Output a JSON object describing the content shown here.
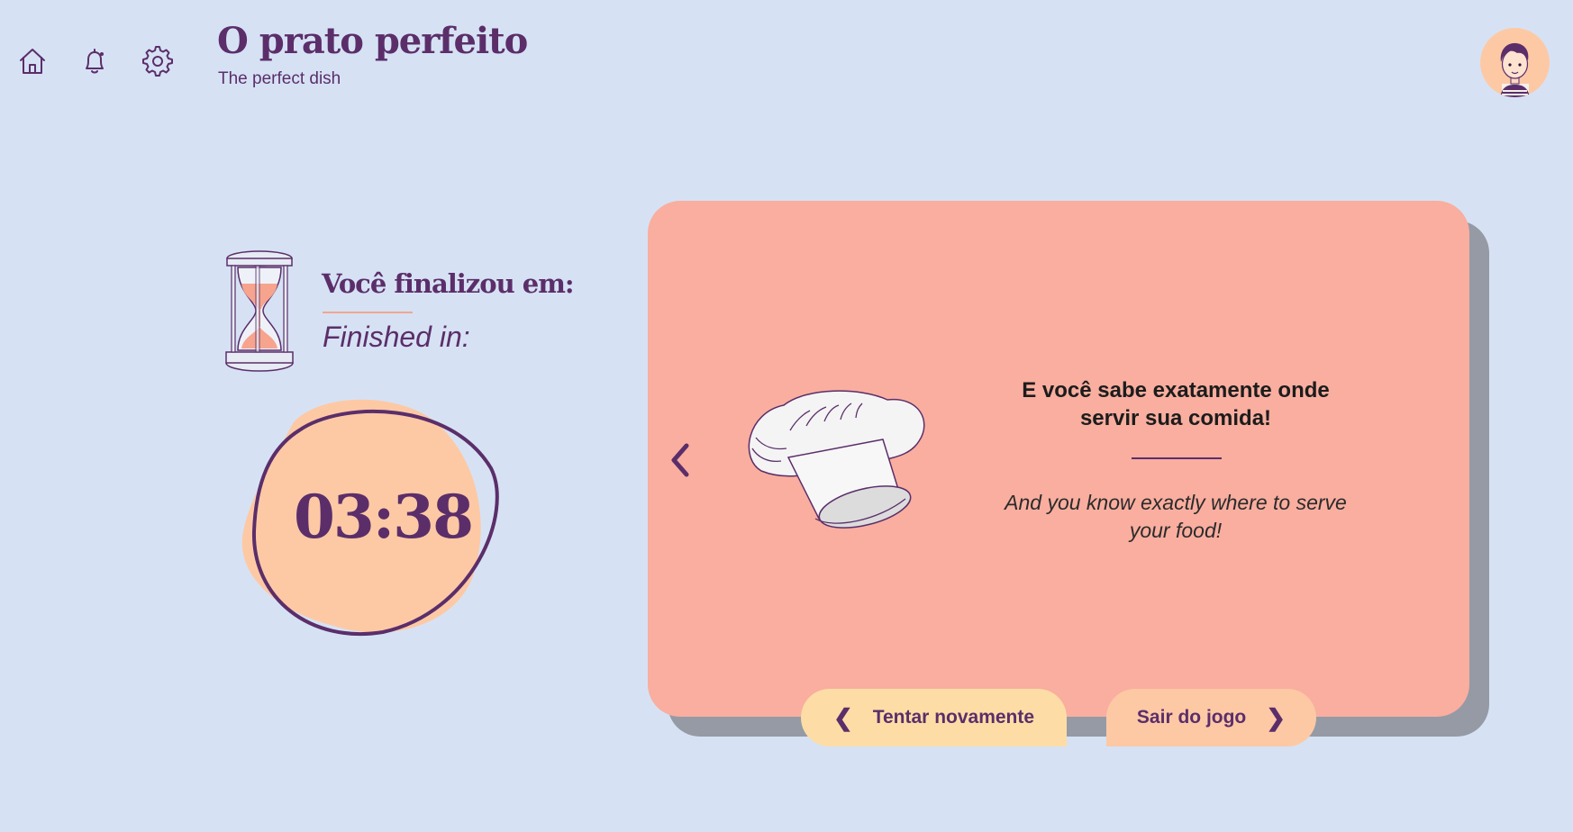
{
  "header": {
    "title": "O prato perfeito",
    "subtitle": "The perfect dish",
    "nav_icons": [
      "home-icon",
      "bell-icon",
      "gear-icon"
    ],
    "avatar_icon": "user-avatar"
  },
  "result": {
    "label_pt": "Você finalizou em:",
    "label_en": "Finished in:",
    "time": "03:38",
    "icon": "hourglass-icon"
  },
  "card": {
    "message_pt": "E você sabe exatamente onde servir sua comida!",
    "message_en": "And you know exactly where to serve your food!",
    "image_icon": "chef-hat-icon",
    "prev_icon": "chevron-left-icon"
  },
  "actions": {
    "retry_label": "Tentar novamente",
    "exit_label": "Sair do jogo"
  },
  "colors": {
    "background": "#d6e2f4",
    "primary": "#5b2e6a",
    "card": "#f9ae9f",
    "card_shadow": "#959aa5",
    "timer_blob": "#fdc9a5",
    "retry_button": "#fddda5",
    "exit_button": "#fdc9a5"
  }
}
